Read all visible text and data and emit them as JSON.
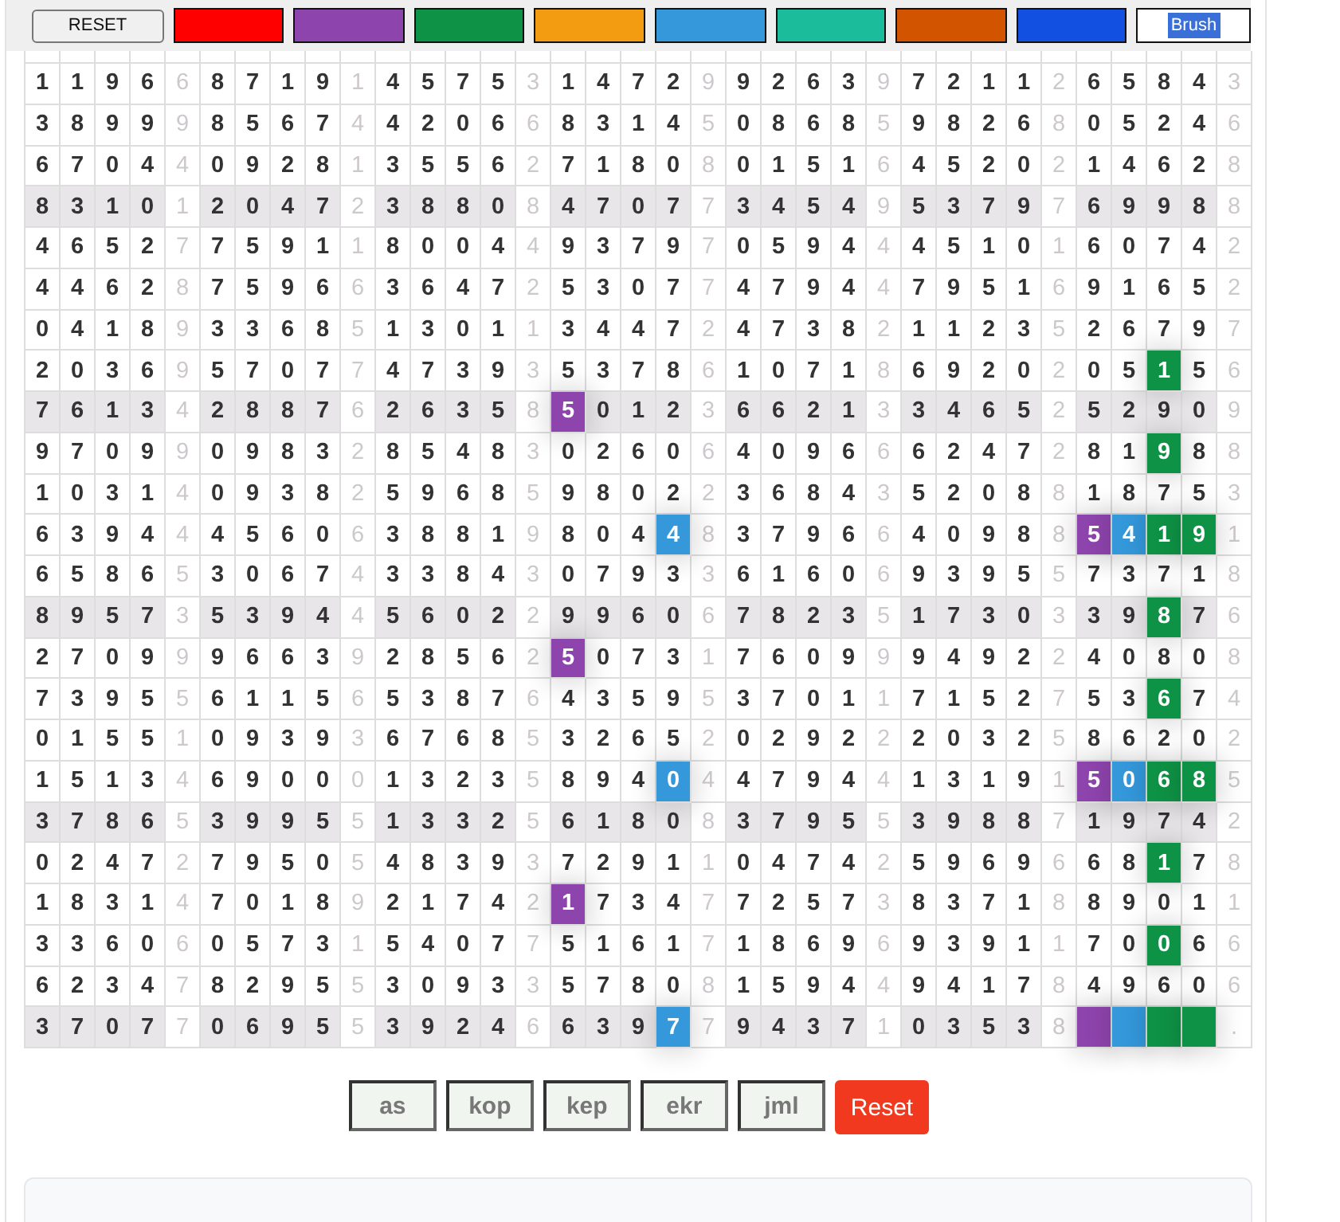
{
  "toolbar": {
    "reset_label": "RESET",
    "palette": [
      {
        "color": "#ff0000"
      },
      {
        "color": "#8e44ad"
      },
      {
        "color": "#0e9245"
      },
      {
        "color": "#f39c12"
      },
      {
        "color": "#3498db"
      },
      {
        "color": "#1abc9c"
      },
      {
        "color": "#d35400"
      },
      {
        "color": "#1150e0"
      }
    ],
    "brush": {
      "value": "Brush",
      "selected_text": true
    }
  },
  "grid": {
    "rows": [
      {
        "shaded": false,
        "cells": [
          "1",
          "1",
          "9",
          "6",
          "6",
          "8",
          "7",
          "1",
          "9",
          "1",
          "4",
          "5",
          "7",
          "5",
          "3",
          "1",
          "4",
          "7",
          "2",
          "9",
          "9",
          "2",
          "6",
          "3",
          "9",
          "7",
          "2",
          "1",
          "1",
          "2",
          "6",
          "5",
          "8",
          "4",
          "3"
        ]
      },
      {
        "shaded": false,
        "cells": [
          "3",
          "8",
          "9",
          "9",
          "9",
          "8",
          "5",
          "6",
          "7",
          "4",
          "4",
          "2",
          "0",
          "6",
          "6",
          "8",
          "3",
          "1",
          "4",
          "5",
          "0",
          "8",
          "6",
          "8",
          "5",
          "9",
          "8",
          "2",
          "6",
          "8",
          "0",
          "5",
          "2",
          "4",
          "6"
        ]
      },
      {
        "shaded": false,
        "cells": [
          "6",
          "7",
          "0",
          "4",
          "4",
          "0",
          "9",
          "2",
          "8",
          "1",
          "3",
          "5",
          "5",
          "6",
          "2",
          "7",
          "1",
          "8",
          "0",
          "8",
          "0",
          "1",
          "5",
          "1",
          "6",
          "4",
          "5",
          "2",
          "0",
          "2",
          "1",
          "4",
          "6",
          "2",
          "8"
        ]
      },
      {
        "shaded": true,
        "cells": [
          "8",
          "3",
          "1",
          "0",
          "1",
          "2",
          "0",
          "4",
          "7",
          "2",
          "3",
          "8",
          "8",
          "0",
          "8",
          "4",
          "7",
          "0",
          "7",
          "7",
          "3",
          "4",
          "5",
          "4",
          "9",
          "5",
          "3",
          "7",
          "9",
          "7",
          "6",
          "9",
          "9",
          "8",
          "8"
        ]
      },
      {
        "shaded": false,
        "cells": [
          "4",
          "6",
          "5",
          "2",
          "7",
          "7",
          "5",
          "9",
          "1",
          "1",
          "8",
          "0",
          "0",
          "4",
          "4",
          "9",
          "3",
          "7",
          "9",
          "7",
          "0",
          "5",
          "9",
          "4",
          "4",
          "4",
          "5",
          "1",
          "0",
          "1",
          "6",
          "0",
          "7",
          "4",
          "2"
        ]
      },
      {
        "shaded": false,
        "cells": [
          "4",
          "4",
          "6",
          "2",
          "8",
          "7",
          "5",
          "9",
          "6",
          "6",
          "3",
          "6",
          "4",
          "7",
          "2",
          "5",
          "3",
          "0",
          "7",
          "7",
          "4",
          "7",
          "9",
          "4",
          "4",
          "7",
          "9",
          "5",
          "1",
          "6",
          "9",
          "1",
          "6",
          "5",
          "2"
        ]
      },
      {
        "shaded": false,
        "cells": [
          "0",
          "4",
          "1",
          "8",
          "9",
          "3",
          "3",
          "6",
          "8",
          "5",
          "1",
          "3",
          "0",
          "1",
          "1",
          "3",
          "4",
          "4",
          "7",
          "2",
          "4",
          "7",
          "3",
          "8",
          "2",
          "1",
          "1",
          "2",
          "3",
          "5",
          "2",
          "6",
          "7",
          "9",
          "7"
        ]
      },
      {
        "shaded": false,
        "cells": [
          "2",
          "0",
          "3",
          "6",
          "9",
          "5",
          "7",
          "0",
          "7",
          "7",
          "4",
          "7",
          "3",
          "9",
          "3",
          "5",
          "3",
          "7",
          "8",
          "6",
          "1",
          "0",
          "7",
          "1",
          "8",
          "6",
          "9",
          "2",
          "0",
          "2",
          "0",
          "5",
          {
            "text": "1",
            "color": "#0e9245"
          },
          "5",
          "6"
        ]
      },
      {
        "shaded": true,
        "cells": [
          "7",
          "6",
          "1",
          "3",
          "4",
          "2",
          "8",
          "8",
          "7",
          "6",
          "2",
          "6",
          "3",
          "5",
          "8",
          {
            "text": "5",
            "color": "#8e44ad"
          },
          "0",
          "1",
          "2",
          "3",
          "6",
          "6",
          "2",
          "1",
          "3",
          "3",
          "4",
          "6",
          "5",
          "2",
          "5",
          "2",
          "9",
          "0",
          "9"
        ]
      },
      {
        "shaded": false,
        "cells": [
          "9",
          "7",
          "0",
          "9",
          "9",
          "0",
          "9",
          "8",
          "3",
          "2",
          "8",
          "5",
          "4",
          "8",
          "3",
          "0",
          "2",
          "6",
          "0",
          "6",
          "4",
          "0",
          "9",
          "6",
          "6",
          "6",
          "2",
          "4",
          "7",
          "2",
          "8",
          "1",
          {
            "text": "9",
            "color": "#0e9245"
          },
          "8",
          "8"
        ]
      },
      {
        "shaded": false,
        "cells": [
          "1",
          "0",
          "3",
          "1",
          "4",
          "0",
          "9",
          "3",
          "8",
          "2",
          "5",
          "9",
          "6",
          "8",
          "5",
          "9",
          "8",
          "0",
          "2",
          "2",
          "3",
          "6",
          "8",
          "4",
          "3",
          "5",
          "2",
          "0",
          "8",
          "8",
          "1",
          "8",
          "7",
          "5",
          "3"
        ]
      },
      {
        "shaded": false,
        "cells": [
          "6",
          "3",
          "9",
          "4",
          "4",
          "4",
          "5",
          "6",
          "0",
          "6",
          "3",
          "8",
          "8",
          "1",
          "9",
          "8",
          "0",
          "4",
          {
            "text": "4",
            "color": "#3498db"
          },
          "8",
          "3",
          "7",
          "9",
          "6",
          "6",
          "4",
          "0",
          "9",
          "8",
          "8",
          {
            "text": "5",
            "color": "#8e44ad"
          },
          {
            "text": "4",
            "color": "#3498db"
          },
          {
            "text": "1",
            "color": "#0e9245"
          },
          {
            "text": "9",
            "color": "#0e9245"
          },
          "1"
        ]
      },
      {
        "shaded": false,
        "cells": [
          "6",
          "5",
          "8",
          "6",
          "5",
          "3",
          "0",
          "6",
          "7",
          "4",
          "3",
          "3",
          "8",
          "4",
          "3",
          "0",
          "7",
          "9",
          "3",
          "3",
          "6",
          "1",
          "6",
          "0",
          "6",
          "9",
          "3",
          "9",
          "5",
          "5",
          "7",
          "3",
          "7",
          "1",
          "8"
        ]
      },
      {
        "shaded": true,
        "cells": [
          "8",
          "9",
          "5",
          "7",
          "3",
          "5",
          "3",
          "9",
          "4",
          "4",
          "5",
          "6",
          "0",
          "2",
          "2",
          "9",
          "9",
          "6",
          "0",
          "6",
          "7",
          "8",
          "2",
          "3",
          "5",
          "1",
          "7",
          "3",
          "0",
          "3",
          "3",
          "9",
          {
            "text": "8",
            "color": "#0e9245"
          },
          "7",
          "6"
        ]
      },
      {
        "shaded": false,
        "cells": [
          "2",
          "7",
          "0",
          "9",
          "9",
          "9",
          "6",
          "6",
          "3",
          "9",
          "2",
          "8",
          "5",
          "6",
          "2",
          {
            "text": "5",
            "color": "#8e44ad"
          },
          "0",
          "7",
          "3",
          "1",
          "7",
          "6",
          "0",
          "9",
          "9",
          "9",
          "4",
          "9",
          "2",
          "2",
          "4",
          "0",
          "8",
          "0",
          "8"
        ]
      },
      {
        "shaded": false,
        "cells": [
          "7",
          "3",
          "9",
          "5",
          "5",
          "6",
          "1",
          "1",
          "5",
          "6",
          "5",
          "3",
          "8",
          "7",
          "6",
          "4",
          "3",
          "5",
          "9",
          "5",
          "3",
          "7",
          "0",
          "1",
          "1",
          "7",
          "1",
          "5",
          "2",
          "7",
          "5",
          "3",
          {
            "text": "6",
            "color": "#0e9245"
          },
          "7",
          "4"
        ]
      },
      {
        "shaded": false,
        "cells": [
          "0",
          "1",
          "5",
          "5",
          "1",
          "0",
          "9",
          "3",
          "9",
          "3",
          "6",
          "7",
          "6",
          "8",
          "5",
          "3",
          "2",
          "6",
          "5",
          "2",
          "0",
          "2",
          "9",
          "2",
          "2",
          "2",
          "0",
          "3",
          "2",
          "5",
          "8",
          "6",
          "2",
          "0",
          "2"
        ]
      },
      {
        "shaded": false,
        "cells": [
          "1",
          "5",
          "1",
          "3",
          "4",
          "6",
          "9",
          "0",
          "0",
          "0",
          "1",
          "3",
          "2",
          "3",
          "5",
          "8",
          "9",
          "4",
          {
            "text": "0",
            "color": "#3498db"
          },
          "4",
          "4",
          "7",
          "9",
          "4",
          "4",
          "1",
          "3",
          "1",
          "9",
          "1",
          {
            "text": "5",
            "color": "#8e44ad"
          },
          {
            "text": "0",
            "color": "#3498db"
          },
          {
            "text": "6",
            "color": "#0e9245"
          },
          {
            "text": "8",
            "color": "#0e9245"
          },
          "5"
        ]
      },
      {
        "shaded": true,
        "cells": [
          "3",
          "7",
          "8",
          "6",
          "5",
          "3",
          "9",
          "9",
          "5",
          "5",
          "1",
          "3",
          "3",
          "2",
          "5",
          "6",
          "1",
          "8",
          "0",
          "8",
          "3",
          "7",
          "9",
          "5",
          "5",
          "3",
          "9",
          "8",
          "8",
          "7",
          "1",
          "9",
          "7",
          "4",
          "2"
        ]
      },
      {
        "shaded": false,
        "cells": [
          "0",
          "2",
          "4",
          "7",
          "2",
          "7",
          "9",
          "5",
          "0",
          "5",
          "4",
          "8",
          "3",
          "9",
          "3",
          "7",
          "2",
          "9",
          "1",
          "1",
          "0",
          "4",
          "7",
          "4",
          "2",
          "5",
          "9",
          "6",
          "9",
          "6",
          "6",
          "8",
          {
            "text": "1",
            "color": "#0e9245"
          },
          "7",
          "8"
        ]
      },
      {
        "shaded": false,
        "cells": [
          "1",
          "8",
          "3",
          "1",
          "4",
          "7",
          "0",
          "1",
          "8",
          "9",
          "2",
          "1",
          "7",
          "4",
          "2",
          {
            "text": "1",
            "color": "#8e44ad"
          },
          "7",
          "3",
          "4",
          "7",
          "7",
          "2",
          "5",
          "7",
          "3",
          "8",
          "3",
          "7",
          "1",
          "8",
          "8",
          "9",
          "0",
          "1",
          "1"
        ]
      },
      {
        "shaded": false,
        "cells": [
          "3",
          "3",
          "6",
          "0",
          "6",
          "0",
          "5",
          "7",
          "3",
          "1",
          "5",
          "4",
          "0",
          "7",
          "7",
          "5",
          "1",
          "6",
          "1",
          "7",
          "1",
          "8",
          "6",
          "9",
          "6",
          "9",
          "3",
          "9",
          "1",
          "1",
          "7",
          "0",
          {
            "text": "0",
            "color": "#0e9245"
          },
          "6",
          "6"
        ]
      },
      {
        "shaded": false,
        "cells": [
          "6",
          "2",
          "3",
          "4",
          "7",
          "8",
          "2",
          "9",
          "5",
          "5",
          "3",
          "0",
          "9",
          "3",
          "3",
          "5",
          "7",
          "8",
          "0",
          "8",
          "1",
          "5",
          "9",
          "4",
          "4",
          "9",
          "4",
          "1",
          "7",
          "8",
          "4",
          "9",
          "6",
          "0",
          "6"
        ]
      },
      {
        "shaded": true,
        "cells": [
          "3",
          "7",
          "0",
          "7",
          "7",
          "0",
          "6",
          "9",
          "5",
          "5",
          "3",
          "9",
          "2",
          "4",
          "6",
          "6",
          "3",
          "9",
          {
            "text": "7",
            "color": "#3498db"
          },
          "7",
          "9",
          "4",
          "3",
          "7",
          "1",
          "0",
          "3",
          "5",
          "3",
          "8",
          {
            "color": "#8e44ad"
          },
          {
            "color": "#3498db"
          },
          {
            "color": "#0e9245"
          },
          {
            "color": "#0e9245"
          },
          "."
        ]
      }
    ]
  },
  "actions": [
    {
      "label": "as",
      "kind": "mode"
    },
    {
      "label": "kop",
      "kind": "mode"
    },
    {
      "label": "kep",
      "kind": "mode"
    },
    {
      "label": "ekr",
      "kind": "mode"
    },
    {
      "label": "jml",
      "kind": "mode"
    },
    {
      "label": "Reset",
      "kind": "reset"
    }
  ]
}
